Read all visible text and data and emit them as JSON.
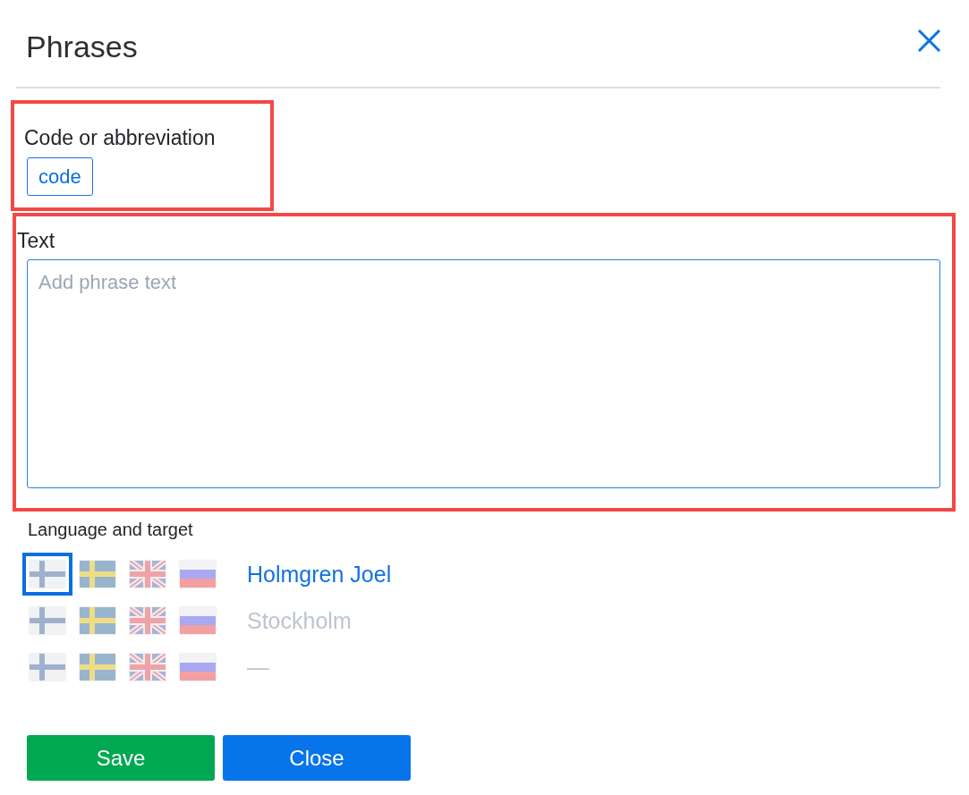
{
  "dialog": {
    "title": "Phrases"
  },
  "code_section": {
    "highlighted": true,
    "label": "Code or abbreviation",
    "value": "code"
  },
  "text_section": {
    "highlighted": true,
    "label": "Text",
    "placeholder": "Add phrase text"
  },
  "language_section": {
    "label": "Language and target",
    "rows": [
      {
        "languages": [
          {
            "kind": "fi",
            "selected": true
          },
          {
            "kind": "se",
            "selected": false
          },
          {
            "kind": "gb",
            "selected": false
          },
          {
            "kind": "ru",
            "selected": false
          }
        ],
        "target": "Holmgren Joel",
        "active": true
      },
      {
        "languages": [
          {
            "kind": "fi",
            "selected": false
          },
          {
            "kind": "se",
            "selected": false
          },
          {
            "kind": "gb",
            "selected": false
          },
          {
            "kind": "ru",
            "selected": false
          }
        ],
        "target": "Stockholm",
        "active": false
      },
      {
        "languages": [
          {
            "kind": "fi",
            "selected": false
          },
          {
            "kind": "se",
            "selected": false
          },
          {
            "kind": "gb",
            "selected": false
          },
          {
            "kind": "ru",
            "selected": false
          }
        ],
        "target": "—",
        "active": false
      }
    ]
  },
  "buttons": [
    {
      "label": "Save",
      "kind": "success"
    },
    {
      "label": "Close",
      "kind": "primary"
    }
  ]
}
